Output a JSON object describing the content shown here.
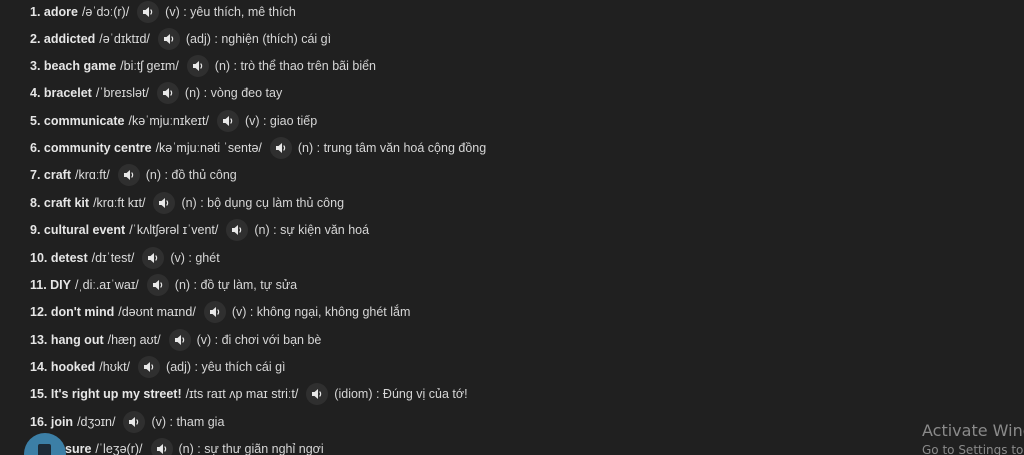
{
  "vocabulary": [
    {
      "word": "1. adore",
      "phonetic": "/əˈdɔː(r)/",
      "meaning": "(v) : yêu thích, mê thích"
    },
    {
      "word": "2. addicted",
      "phonetic": "/əˈdɪktɪd/",
      "meaning": "(adj) : nghiện (thích) cái gì"
    },
    {
      "word": "3. beach game",
      "phonetic": "/biːtʃ ɡeɪm/",
      "meaning": "(n) : trò thể thao trên bãi biển"
    },
    {
      "word": "4. bracelet",
      "phonetic": "/ˈbreɪslət/",
      "meaning": "(n) : vòng đeo tay"
    },
    {
      "word": "5. communicate",
      "phonetic": "/kəˈmjuːnɪkeɪt/",
      "meaning": "(v) : giao tiếp"
    },
    {
      "word": "6. community centre",
      "phonetic": "/kəˈmjuːnəti ˈsentə/",
      "meaning": "(n) : trung tâm văn hoá cộng đồng"
    },
    {
      "word": "7. craft",
      "phonetic": "/krɑːft/",
      "meaning": "(n) : đồ thủ công"
    },
    {
      "word": "8. craft kit",
      "phonetic": "/krɑːft kɪt/",
      "meaning": "(n) : bộ dụng cụ làm thủ công"
    },
    {
      "word": "9. cultural event",
      "phonetic": "/ˈkʌltʃərəl ɪˈvent/",
      "meaning": "(n) : sự kiện văn hoá"
    },
    {
      "word": "10. detest",
      "phonetic": "/dɪˈtest/",
      "meaning": "(v) : ghét"
    },
    {
      "word": "11. DIY",
      "phonetic": "/ˌdiː.aɪˈwaɪ/",
      "meaning": "(n) : đồ tự làm, tự sửa"
    },
    {
      "word": "12. don't mind",
      "phonetic": "/dəʊnt maɪnd/",
      "meaning": "(v) : không ngại, không ghét lắm"
    },
    {
      "word": "13. hang out",
      "phonetic": "/hæŋ aʊt/",
      "meaning": "(v) : đi chơi với bạn bè"
    },
    {
      "word": "14. hooked",
      "phonetic": "/hʊkt/",
      "meaning": "(adj) : yêu thích cái gì"
    },
    {
      "word": "15. It's right up my street!",
      "phonetic": "/ɪts raɪt ʌp maɪ striːt/",
      "meaning": "(idiom) : Đúng vị của tớ!"
    },
    {
      "word": "16. join",
      "phonetic": "/dʒɔɪn/",
      "meaning": "(v) : tham gia"
    },
    {
      "word": "sure",
      "phonetic": "/ˈleʒə(r)/",
      "meaning": "(n) : sự thư giãn nghỉ ngơi"
    }
  ],
  "icons": {
    "speaker": "speaker-icon",
    "fab": "document-icon"
  },
  "colors": {
    "background": "#202020",
    "text": "#dadada",
    "fab": "#3c7fa6"
  },
  "watermark": {
    "title": "Activate Wind",
    "subtitle": "Go to Settings to a"
  }
}
